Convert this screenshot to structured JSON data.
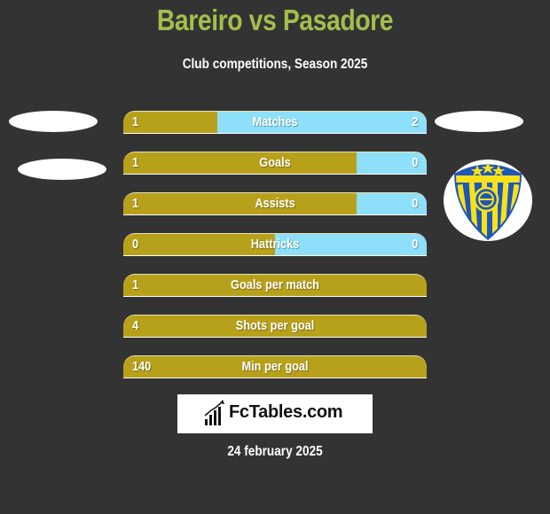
{
  "header": {
    "title": "Bareiro vs Pasadore",
    "subtitle": "Club competitions, Season 2025"
  },
  "colors": {
    "title": "#a3be4c",
    "left_bar": "#b8a11a",
    "right_bar": "#8ee0fa",
    "background": "#333333"
  },
  "stats": [
    {
      "label": "Matches",
      "left": "1",
      "right": "2",
      "right_share": 0.69
    },
    {
      "label": "Goals",
      "left": "1",
      "right": "0",
      "right_share": 0.23
    },
    {
      "label": "Assists",
      "left": "1",
      "right": "0",
      "right_share": 0.23
    },
    {
      "label": "Hattricks",
      "left": "0",
      "right": "0",
      "right_share": 0.5
    },
    {
      "label": "Goals per match",
      "left": "1",
      "right": "",
      "right_share": 0
    },
    {
      "label": "Shots per goal",
      "left": "4",
      "right": "",
      "right_share": 0
    },
    {
      "label": "Min per goal",
      "left": "140",
      "right": "",
      "right_share": 0
    }
  ],
  "right_team_badge": "club-crest-icon",
  "footer": {
    "brand": "FcTables.com",
    "date": "24 february 2025"
  }
}
